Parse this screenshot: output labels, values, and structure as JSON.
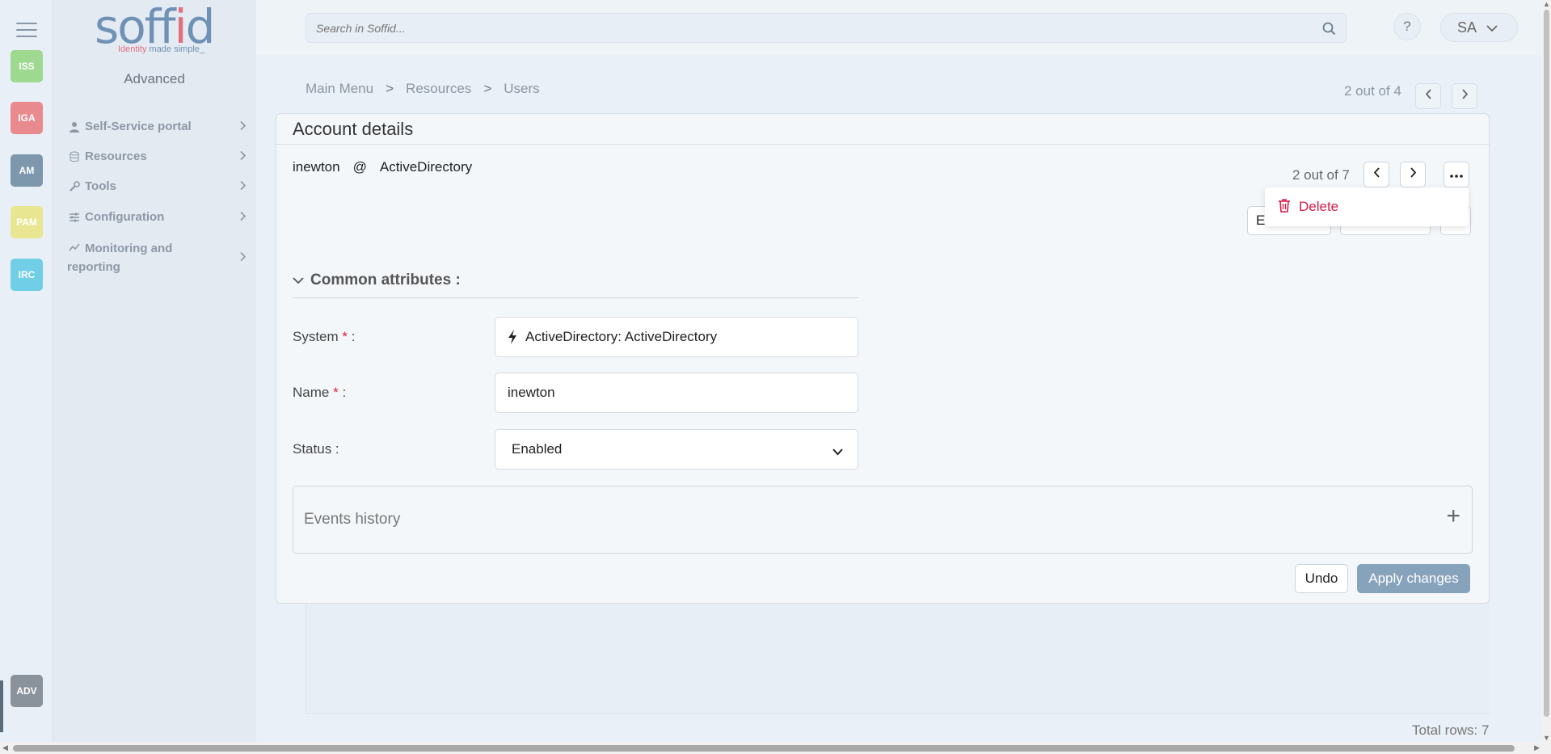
{
  "rail": {
    "apps": [
      {
        "label": "ISS",
        "color": "#9dd98f"
      },
      {
        "label": "IGA",
        "color": "#e98a8f"
      },
      {
        "label": "AM",
        "color": "#7d97ad"
      },
      {
        "label": "PAM",
        "color": "#e8e690"
      },
      {
        "label": "IRC",
        "color": "#70cfe6"
      },
      {
        "label": "ADV",
        "color": "#8a939c"
      }
    ]
  },
  "logo": {
    "word": "soffid",
    "tag_part1": "Identity",
    "tag_part2": " made simple_"
  },
  "sidebar": {
    "section": "Advanced",
    "items": [
      {
        "label": "Self-Service portal",
        "icon": "user-icon"
      },
      {
        "label": "Resources",
        "icon": "database-icon"
      },
      {
        "label": "Tools",
        "icon": "wrench-icon"
      },
      {
        "label": "Configuration",
        "icon": "sliders-icon"
      },
      {
        "label": "Monitoring and reporting",
        "icon": "chart-line-icon"
      }
    ]
  },
  "topbar": {
    "search_placeholder": "Search in Soffid...",
    "help": "?",
    "user_initials": "SA"
  },
  "breadcrumb": [
    "Main Menu",
    "Resources",
    "Users"
  ],
  "pager_top": "2 out of 4",
  "card": {
    "title": "Account details",
    "account_name": "inewton",
    "at": "@",
    "system_name": "ActiveDirectory",
    "pager": "2 out of 7",
    "hidden_button_initial": "E",
    "dropdown_delete": "Delete",
    "section_title": "Common attributes :",
    "fields": {
      "system_label": "System",
      "system_value": "ActiveDirectory: ActiveDirectory",
      "name_label": "Name",
      "name_value": "inewton",
      "status_label": "Status :",
      "status_value": "Enabled"
    },
    "required_mark": "*",
    "colon": ":",
    "events_history": "Events history",
    "undo": "Undo",
    "apply": "Apply changes"
  },
  "total_rows": "Total rows: 7"
}
